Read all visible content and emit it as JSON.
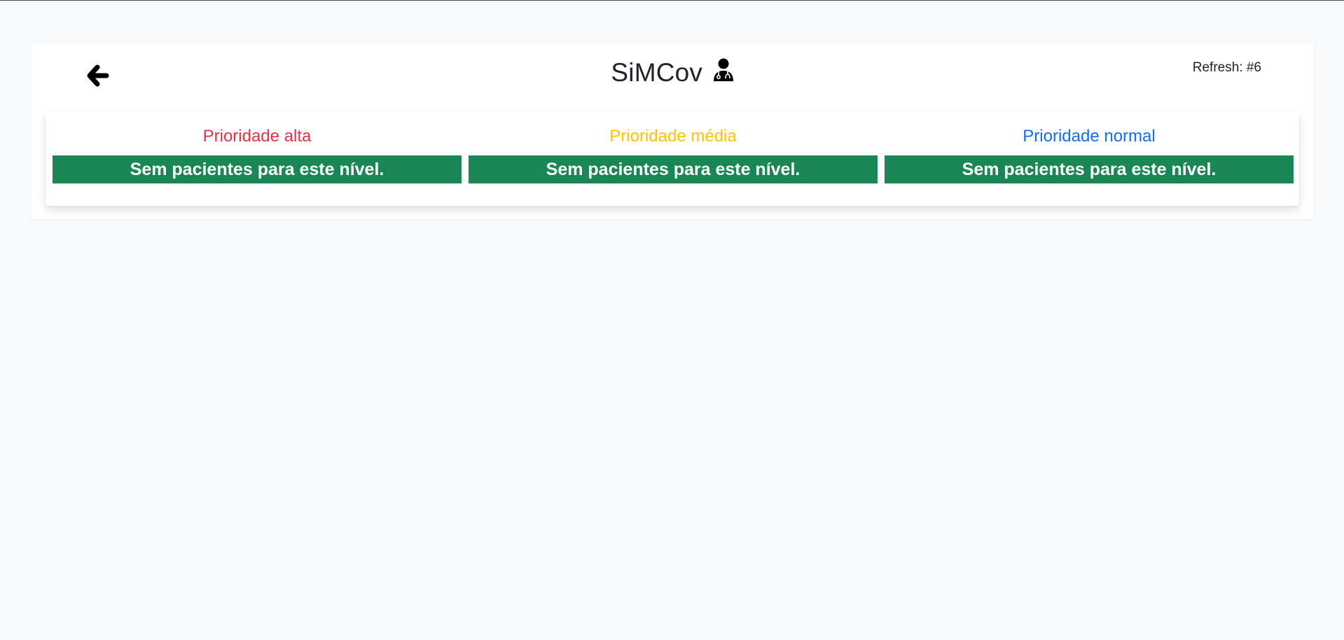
{
  "header": {
    "title": "SiMCov",
    "refresh_text": "Refresh: #6",
    "back_icon": "arrow-left-icon",
    "title_icon": "user-doctor-icon"
  },
  "columns": [
    {
      "title": "Prioridade alta",
      "empty_message": "Sem pacientes para este nível.",
      "color": "#dc3545"
    },
    {
      "title": "Prioridade média",
      "empty_message": "Sem pacientes para este nível.",
      "color": "#ffc107"
    },
    {
      "title": "Prioridade normal",
      "empty_message": "Sem pacientes para este nível.",
      "color": "#0d6efd"
    }
  ],
  "colors": {
    "empty_bar_background": "#198754",
    "page_background": "#f8f9fa"
  }
}
